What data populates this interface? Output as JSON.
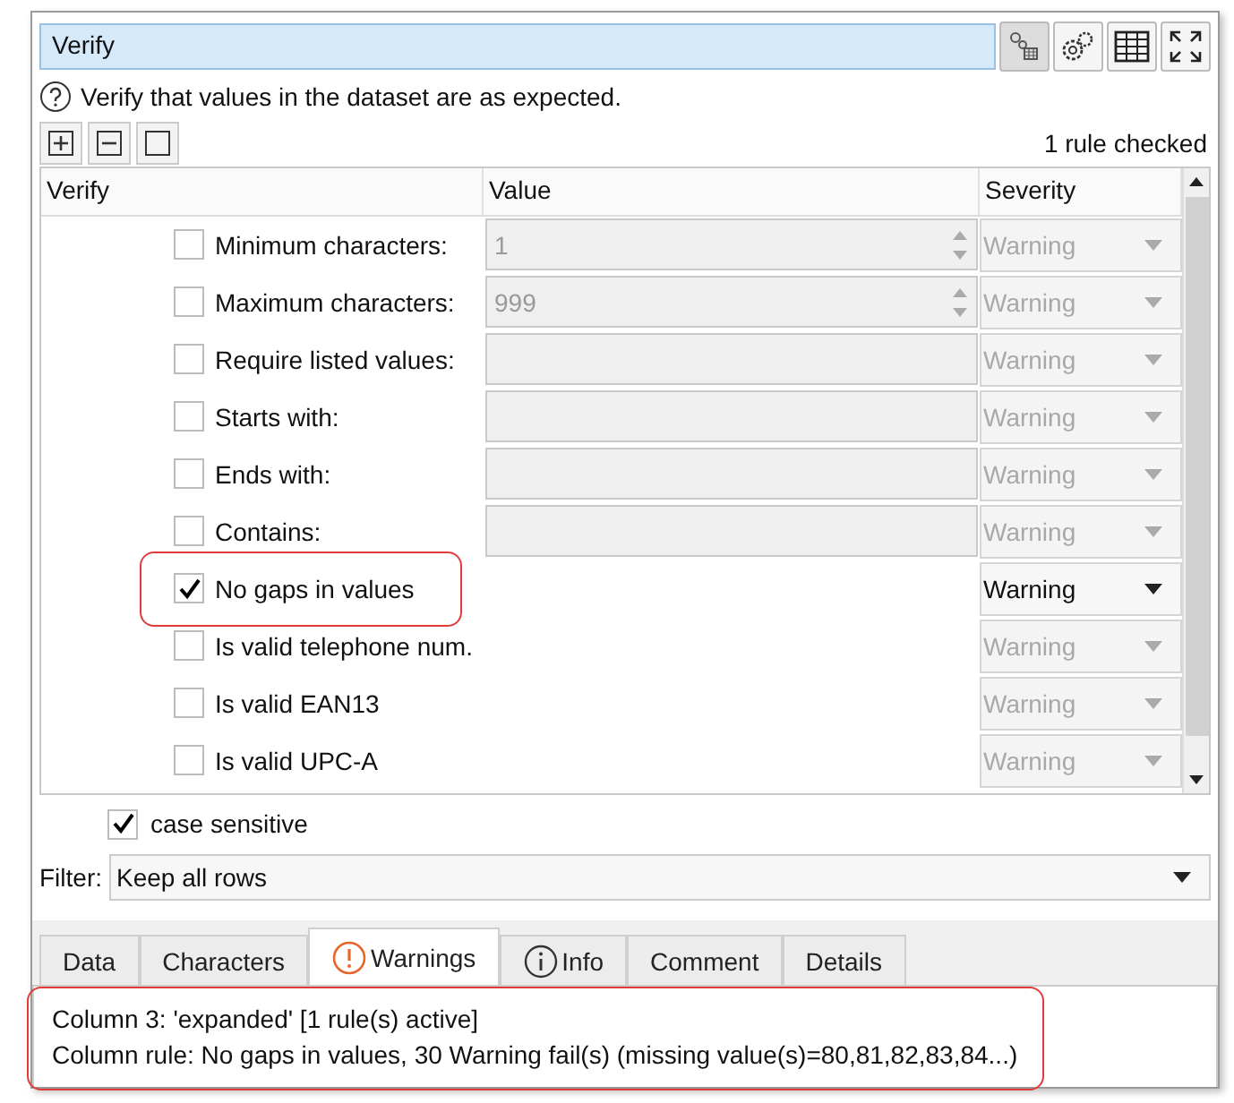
{
  "title": "Verify",
  "description": "Verify that values in the dataset are as expected.",
  "rule_count": "1 rule checked",
  "columns": [
    "Verify",
    "Value",
    "Severity"
  ],
  "rules": [
    {
      "kind": "spin",
      "label": "Minimum characters:",
      "checked": false,
      "value": "1",
      "severity": "Warning",
      "highlighted": false
    },
    {
      "kind": "spin",
      "label": "Maximum characters:",
      "checked": false,
      "value": "999",
      "severity": "Warning",
      "highlighted": false
    },
    {
      "kind": "text",
      "label": "Require listed values:",
      "checked": false,
      "severity": "Warning",
      "highlighted": false
    },
    {
      "kind": "text",
      "label": "Starts with:",
      "checked": false,
      "severity": "Warning",
      "highlighted": false
    },
    {
      "kind": "text",
      "label": "Ends with:",
      "checked": false,
      "severity": "Warning",
      "highlighted": false
    },
    {
      "kind": "text",
      "label": "Contains:",
      "checked": false,
      "severity": "Warning",
      "highlighted": false
    },
    {
      "kind": "plain",
      "label": "No gaps in values",
      "checked": true,
      "severity": "Warning",
      "highlighted": true
    },
    {
      "kind": "plain",
      "label": "Is valid telephone num.",
      "checked": false,
      "severity": "Warning",
      "highlighted": false
    },
    {
      "kind": "plain",
      "label": "Is valid EAN13",
      "checked": false,
      "severity": "Warning",
      "highlighted": false
    },
    {
      "kind": "plain",
      "label": "Is valid UPC-A",
      "checked": false,
      "severity": "Warning",
      "highlighted": false
    }
  ],
  "case_sensitive": {
    "label": "case sensitive",
    "checked": true
  },
  "filter": {
    "label": "Filter:",
    "value": "Keep all rows"
  },
  "tabs": [
    {
      "label": "Data",
      "selected": false,
      "kind": "plain"
    },
    {
      "label": "Characters",
      "selected": false,
      "kind": "plain"
    },
    {
      "label": "Warnings",
      "selected": true,
      "kind": "warning"
    },
    {
      "label": "Info",
      "selected": false,
      "kind": "info"
    },
    {
      "label": "Comment",
      "selected": false,
      "kind": "plain"
    },
    {
      "label": "Details",
      "selected": false,
      "kind": "plain"
    }
  ],
  "output": {
    "highlighted": true,
    "lines": [
      "Column 3: 'expanded' [1 rule(s) active]",
      "Column rule: No gaps in values, 30 Warning fail(s) (missing value(s)=80,81,82,83,84...)"
    ]
  }
}
